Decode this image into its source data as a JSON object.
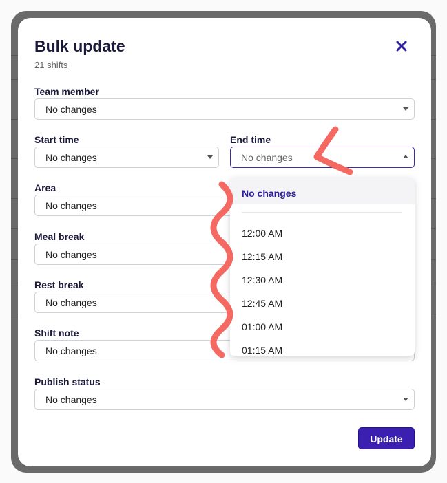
{
  "modal": {
    "title": "Bulk update",
    "subtitle": "21 shifts",
    "close_icon": "close-icon"
  },
  "fields": {
    "team_member": {
      "label": "Team member",
      "value": "No changes"
    },
    "start_time": {
      "label": "Start time",
      "value": "No changes"
    },
    "end_time": {
      "label": "End time",
      "value": "No changes"
    },
    "area": {
      "label": "Area",
      "value": "No changes"
    },
    "meal_break": {
      "label": "Meal break",
      "value": "No changes"
    },
    "rest_break": {
      "label": "Rest break",
      "value": "No changes"
    },
    "shift_note": {
      "label": "Shift note",
      "value": "No changes"
    },
    "publish_status": {
      "label": "Publish status",
      "value": "No changes"
    }
  },
  "end_time_dropdown": {
    "selected": "No changes",
    "options": [
      "12:00 AM",
      "12:15 AM",
      "12:30 AM",
      "12:45 AM",
      "01:00 AM",
      "01:15 AM"
    ]
  },
  "update_button": "Update",
  "colors": {
    "accent": "#3a1fb0",
    "title_text": "#1c1a3a",
    "annotation": "#f46a63"
  }
}
